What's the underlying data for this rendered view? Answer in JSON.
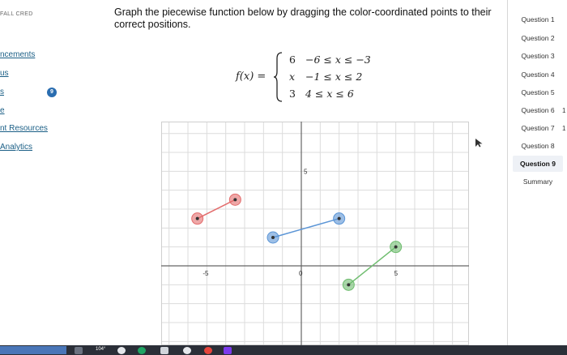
{
  "nav": {
    "course_code": "FALL CRED",
    "items": [
      {
        "label": "ncements"
      },
      {
        "label": "us"
      },
      {
        "label": "s"
      },
      {
        "label": "e"
      },
      {
        "label": "nt Resources"
      },
      {
        "label": "Analytics"
      }
    ],
    "badge": "9"
  },
  "question": {
    "prompt": "Graph the piecewise function below by dragging the color-coordinated points to their correct positions.",
    "function_name": "f(x) =",
    "cases": [
      {
        "value": "6",
        "condition": "−6 ≤ x ≤ −3"
      },
      {
        "value": "x",
        "condition": "−1 ≤ x ≤ 2"
      },
      {
        "value": "3",
        "condition": "4 ≤ x ≤ 6"
      }
    ]
  },
  "graph": {
    "x_range": [
      -9,
      9
    ],
    "y_range": [
      -4,
      8
    ],
    "tick_labels": {
      "x_neg5": "-5",
      "origin": "0",
      "x_pos5": "5",
      "y_pos5": "5"
    },
    "segments": [
      {
        "name": "red",
        "color": "#e36c6c",
        "p1": [
          -5.5,
          2.5
        ],
        "p2": [
          -3.5,
          3.5
        ]
      },
      {
        "name": "blue",
        "color": "#5b95d6",
        "p1": [
          -1.5,
          1.5
        ],
        "p2": [
          2,
          2.5
        ]
      },
      {
        "name": "green",
        "color": "#6fbd6f",
        "p1": [
          2.5,
          -1
        ],
        "p2": [
          5,
          1
        ]
      }
    ]
  },
  "questions": {
    "items": [
      "Question 1",
      "Question 2",
      "Question 3",
      "Question 4",
      "Question 5",
      "Question 6",
      "Question 7",
      "Question 8",
      "Question 9",
      "Summary"
    ],
    "active_index": 8,
    "side_marks": [
      "1",
      "1"
    ]
  },
  "taskbar": {
    "temperature": "104°"
  }
}
